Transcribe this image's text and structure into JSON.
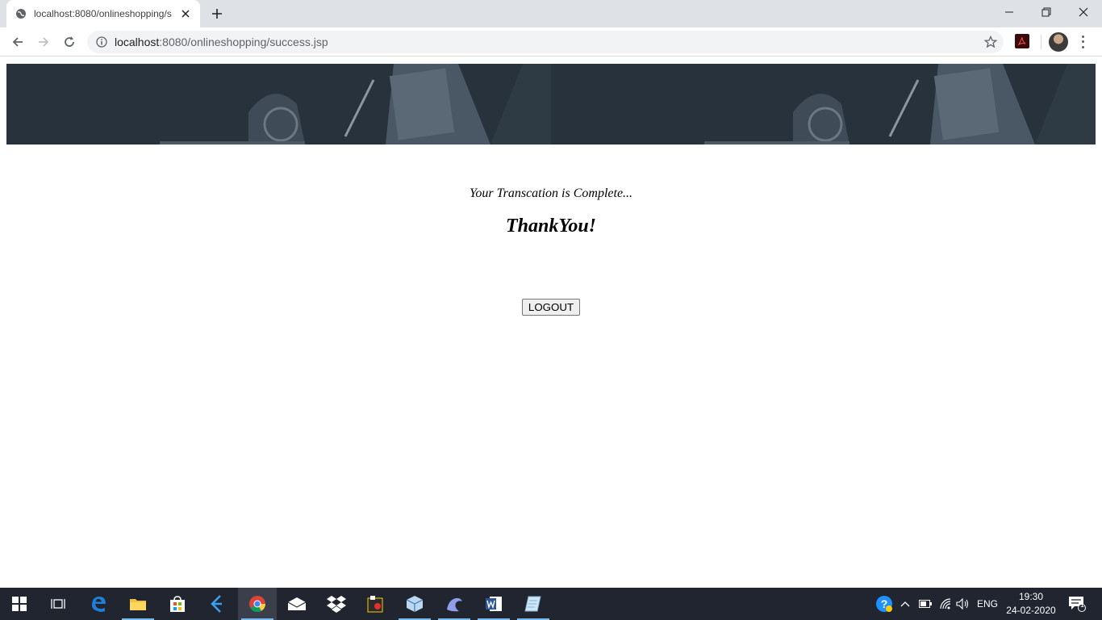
{
  "browser": {
    "tab_title": "localhost:8080/onlineshopping/s",
    "url_host": "localhost",
    "url_rest": ":8080/onlineshopping/success.jsp"
  },
  "page": {
    "message": "Your Transcation is Complete...",
    "thanks": "ThankYou!",
    "logout_label": "LOGOUT"
  },
  "taskbar": {
    "language": "ENG",
    "time": "19:30",
    "date": "24-02-2020",
    "notifications": "1"
  },
  "colors": {
    "banner": "#27323c",
    "taskbar": "#202530",
    "tabstrip": "#dee1e6"
  }
}
